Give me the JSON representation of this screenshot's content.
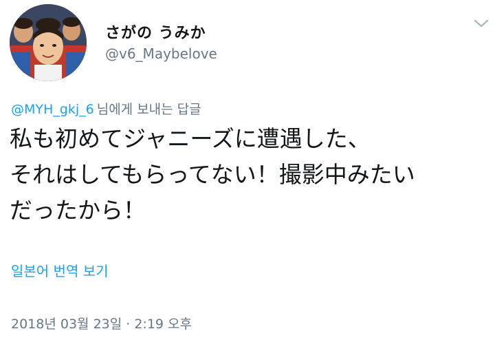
{
  "user": {
    "display_name": "さがの うみか",
    "handle": "@v6_Maybelove"
  },
  "reply": {
    "mention": "@MYH_gkj_6",
    "suffix": "님에게 보내는 답글"
  },
  "tweet": {
    "lines": [
      "私も初めてジャニーズに遭遇した、",
      "それはしてもらってない！撮影中みたい",
      "だったから！"
    ]
  },
  "translate_label": "일본어 번역 보기",
  "timestamp": "2018년 03월 23일 · 2:19 오후",
  "colors": {
    "accent": "#1da1f2",
    "secondary_text": "#657786",
    "primary_text": "#14171a"
  },
  "icons": {
    "menu": "chevron-down-icon"
  }
}
